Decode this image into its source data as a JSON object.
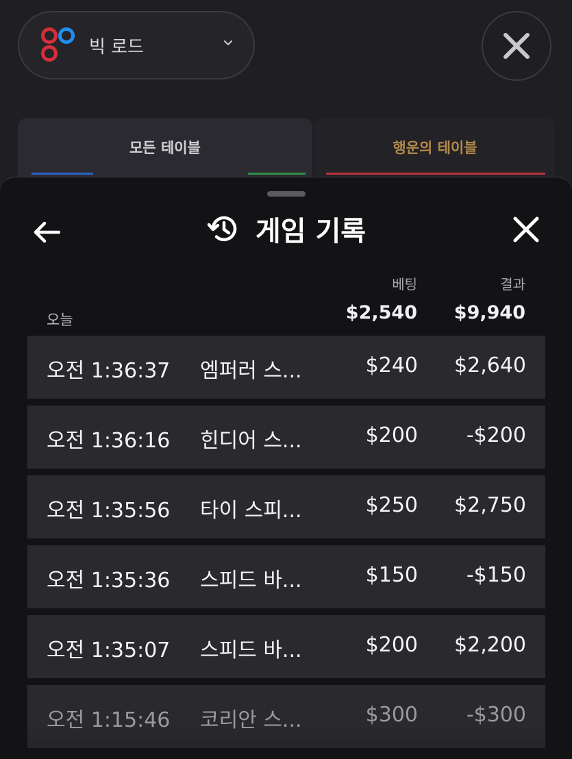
{
  "background": {
    "road_selector": {
      "label": "빅 로드",
      "icon": "big-road-logo-icon"
    },
    "close_icon": "close-icon",
    "tabs": [
      {
        "label": "모든 테이블",
        "active": true
      },
      {
        "label": "행운의 테이블",
        "active": false,
        "color": "#b48a4a"
      }
    ]
  },
  "sheet": {
    "title": "게임 기록",
    "title_icon": "history-icon",
    "back_icon": "arrow-left-icon",
    "close_icon": "close-icon",
    "columns": {
      "bet": "베팅",
      "result": "결과"
    },
    "summary": {
      "label": "오늘",
      "bet_total": "$2,540",
      "result_total": "$9,940"
    },
    "rows": [
      {
        "time": "오전 1:36:37",
        "game": "엠퍼러 스...",
        "bet": "$240",
        "result": "$2,640"
      },
      {
        "time": "오전 1:36:16",
        "game": "힌디어 스...",
        "bet": "$200",
        "result": "-$200"
      },
      {
        "time": "오전 1:35:56",
        "game": "타이 스피...",
        "bet": "$250",
        "result": "$2,750"
      },
      {
        "time": "오전 1:35:36",
        "game": "스피드 바...",
        "bet": "$150",
        "result": "-$150"
      },
      {
        "time": "오전 1:35:07",
        "game": "스피드 바...",
        "bet": "$200",
        "result": "$2,200"
      },
      {
        "time": "오전 1:15:46",
        "game": "코리안 스...",
        "bet": "$300",
        "result": "-$300"
      }
    ]
  },
  "colors": {
    "accent_gold": "#b48a4a",
    "road_red": "#d62f3b",
    "road_blue": "#1f8ff0"
  }
}
